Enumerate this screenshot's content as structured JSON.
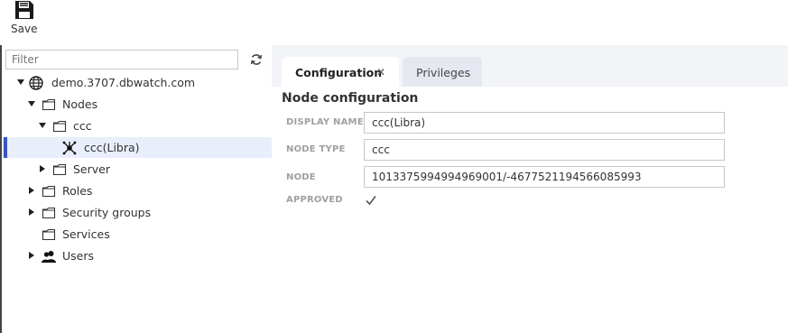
{
  "toolbar": {
    "save_label": "Save"
  },
  "sidebar": {
    "filter_placeholder": "Filter",
    "tree": [
      {
        "label": "demo.3707.dbwatch.com",
        "icon": "globe-icon",
        "expanded": true
      },
      {
        "label": "Nodes",
        "icon": "folder-icon",
        "expanded": true
      },
      {
        "label": "ccc",
        "icon": "folder-icon",
        "expanded": true
      },
      {
        "label": "ccc(Libra)",
        "icon": "node-icon",
        "selected": true
      },
      {
        "label": "Server",
        "icon": "folder-icon",
        "expanded": false
      },
      {
        "label": "Roles",
        "icon": "folder-icon",
        "expanded": false
      },
      {
        "label": "Security groups",
        "icon": "folder-icon",
        "expanded": false
      },
      {
        "label": "Services",
        "icon": "folder-icon"
      },
      {
        "label": "Users",
        "icon": "users-icon",
        "expanded": false
      }
    ]
  },
  "tabs": [
    {
      "label": "Configuration",
      "active": true,
      "close": "✕"
    },
    {
      "label": "Privileges",
      "active": false
    }
  ],
  "form": {
    "title": "Node configuration",
    "fields": [
      {
        "label": "DISPLAY NAME",
        "value": "ccc(Libra)"
      },
      {
        "label": "NODE TYPE",
        "value": "ccc"
      },
      {
        "label": "NODE",
        "value": "1013375994994969001/-4677521194566085993"
      },
      {
        "label": "APPROVED",
        "checked": true
      }
    ]
  },
  "colors": {
    "accent": "#3a55c6",
    "selected_bg": "#e9eefb",
    "tab_bar": "#f3f4f8"
  }
}
